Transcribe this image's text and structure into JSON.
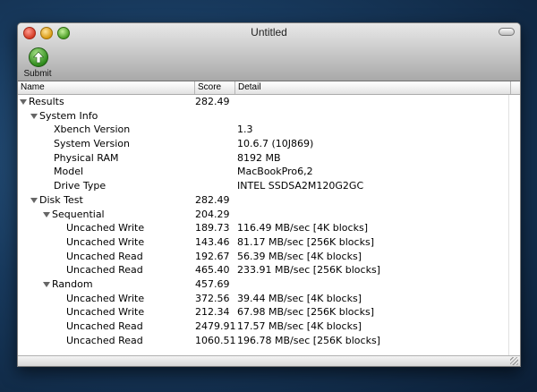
{
  "window": {
    "title": "Untitled"
  },
  "toolbar": {
    "submit_label": "Submit",
    "submit_icon": "upload-arrow-icon"
  },
  "columns": {
    "name": "Name",
    "score": "Score",
    "detail": "Detail"
  },
  "rows": [
    {
      "label": "Results",
      "score": "282.49",
      "detail": "",
      "level": 0,
      "expand": true
    },
    {
      "label": "System Info",
      "score": "",
      "detail": "",
      "level": 1,
      "expand": true
    },
    {
      "label": "Xbench Version",
      "score": "",
      "detail": "1.3",
      "level": 2,
      "expand": false
    },
    {
      "label": "System Version",
      "score": "",
      "detail": "10.6.7 (10J869)",
      "level": 2,
      "expand": false
    },
    {
      "label": "Physical RAM",
      "score": "",
      "detail": "8192 MB",
      "level": 2,
      "expand": false
    },
    {
      "label": "Model",
      "score": "",
      "detail": "MacBookPro6,2",
      "level": 2,
      "expand": false
    },
    {
      "label": "Drive Type",
      "score": "",
      "detail": "INTEL SSDSA2M120G2GC",
      "level": 2,
      "expand": false
    },
    {
      "label": "Disk Test",
      "score": "282.49",
      "detail": "",
      "level": 1,
      "expand": true
    },
    {
      "label": "Sequential",
      "score": "204.29",
      "detail": "",
      "level": 2,
      "expand": true
    },
    {
      "label": "Uncached Write",
      "score": "189.73",
      "detail": "116.49 MB/sec [4K blocks]",
      "level": 3,
      "expand": false
    },
    {
      "label": "Uncached Write",
      "score": "143.46",
      "detail": "81.17 MB/sec [256K blocks]",
      "level": 3,
      "expand": false
    },
    {
      "label": "Uncached Read",
      "score": "192.67",
      "detail": "56.39 MB/sec [4K blocks]",
      "level": 3,
      "expand": false
    },
    {
      "label": "Uncached Read",
      "score": "465.40",
      "detail": "233.91 MB/sec [256K blocks]",
      "level": 3,
      "expand": false
    },
    {
      "label": "Random",
      "score": "457.69",
      "detail": "",
      "level": 2,
      "expand": true
    },
    {
      "label": "Uncached Write",
      "score": "372.56",
      "detail": "39.44 MB/sec [4K blocks]",
      "level": 3,
      "expand": false
    },
    {
      "label": "Uncached Write",
      "score": "212.34",
      "detail": "67.98 MB/sec [256K blocks]",
      "level": 3,
      "expand": false
    },
    {
      "label": "Uncached Read",
      "score": "2479.91",
      "detail": "17.57 MB/sec [4K blocks]",
      "level": 3,
      "expand": false
    },
    {
      "label": "Uncached Read",
      "score": "1060.51",
      "detail": "196.78 MB/sec [256K blocks]",
      "level": 3,
      "expand": false
    }
  ]
}
